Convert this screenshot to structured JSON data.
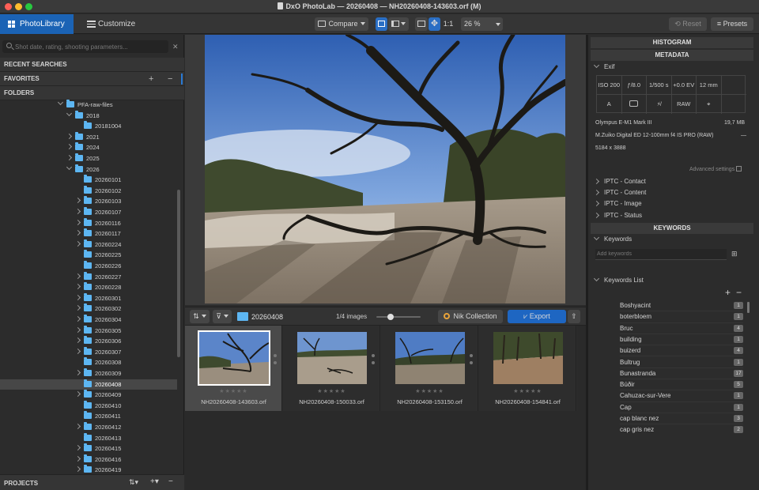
{
  "window": {
    "title": "DxO PhotoLab — 20260408 — NH20260408-143603.orf (M)"
  },
  "toolbar": {
    "tab_photolibrary": "PhotoLibrary",
    "tab_customize": "Customize",
    "compare_label": "Compare",
    "ratio_label": "1:1",
    "zoom_value": "26 %",
    "reset_label": "Reset",
    "presets_label": "Presets"
  },
  "left": {
    "search_placeholder": "Shot date, rating, shooting parameters...",
    "recent_searches": "RECENT SEARCHES",
    "favorites": "FAVORITES",
    "folders": "FOLDERS",
    "projects": "PROJECTS",
    "tree": [
      {
        "label": "PFA-raw-files",
        "depth": 0,
        "chevron": "open"
      },
      {
        "label": "2018",
        "depth": 1,
        "chevron": "open"
      },
      {
        "label": "20181004",
        "depth": 2,
        "chevron": "none"
      },
      {
        "label": "2021",
        "depth": 1,
        "chevron": "closed"
      },
      {
        "label": "2024",
        "depth": 1,
        "chevron": "closed"
      },
      {
        "label": "2025",
        "depth": 1,
        "chevron": "closed"
      },
      {
        "label": "2026",
        "depth": 1,
        "chevron": "open"
      },
      {
        "label": "20260101",
        "depth": 2,
        "chevron": "none"
      },
      {
        "label": "20260102",
        "depth": 2,
        "chevron": "none"
      },
      {
        "label": "20260103",
        "depth": 2,
        "chevron": "closed"
      },
      {
        "label": "20260107",
        "depth": 2,
        "chevron": "closed"
      },
      {
        "label": "20260116",
        "depth": 2,
        "chevron": "closed"
      },
      {
        "label": "20260117",
        "depth": 2,
        "chevron": "closed"
      },
      {
        "label": "20260224",
        "depth": 2,
        "chevron": "closed"
      },
      {
        "label": "20260225",
        "depth": 2,
        "chevron": "none"
      },
      {
        "label": "20260226",
        "depth": 2,
        "chevron": "none"
      },
      {
        "label": "20260227",
        "depth": 2,
        "chevron": "closed"
      },
      {
        "label": "20260228",
        "depth": 2,
        "chevron": "closed"
      },
      {
        "label": "20260301",
        "depth": 2,
        "chevron": "closed"
      },
      {
        "label": "20260302",
        "depth": 2,
        "chevron": "closed"
      },
      {
        "label": "20260304",
        "depth": 2,
        "chevron": "closed"
      },
      {
        "label": "20260305",
        "depth": 2,
        "chevron": "closed"
      },
      {
        "label": "20260306",
        "depth": 2,
        "chevron": "closed"
      },
      {
        "label": "20260307",
        "depth": 2,
        "chevron": "closed"
      },
      {
        "label": "20260308",
        "depth": 2,
        "chevron": "none"
      },
      {
        "label": "20260309",
        "depth": 2,
        "chevron": "closed"
      },
      {
        "label": "20260408",
        "depth": 2,
        "chevron": "none",
        "selected": true
      },
      {
        "label": "20260409",
        "depth": 2,
        "chevron": "closed"
      },
      {
        "label": "20260410",
        "depth": 2,
        "chevron": "none"
      },
      {
        "label": "20260411",
        "depth": 2,
        "chevron": "none"
      },
      {
        "label": "20260412",
        "depth": 2,
        "chevron": "closed"
      },
      {
        "label": "20260413",
        "depth": 2,
        "chevron": "none"
      },
      {
        "label": "20260415",
        "depth": 2,
        "chevron": "closed"
      },
      {
        "label": "20260416",
        "depth": 2,
        "chevron": "closed"
      },
      {
        "label": "20260419",
        "depth": 2,
        "chevron": "closed"
      }
    ]
  },
  "center": {
    "folder_name": "20260408",
    "image_count": "1/4 images",
    "nik_label": "Nik Collection",
    "export_label": "Export",
    "thumbnails": [
      {
        "name": "NH20260408-143603.orf",
        "selected": true
      },
      {
        "name": "NH20260408-150033.orf",
        "selected": false
      },
      {
        "name": "NH20260408-153150.orf",
        "selected": false
      },
      {
        "name": "NH20260408-154841.orf",
        "selected": false
      }
    ],
    "stars": "★★★★★"
  },
  "right": {
    "histogram": "HISTOGRAM",
    "metadata": "METADATA",
    "exif": "Exif",
    "exif_values": [
      "ISO 200",
      "ƒ/8.0",
      "1/500 s",
      "+0.0 EV",
      "12 mm"
    ],
    "exif_row2": [
      "A",
      "",
      "",
      "RAW",
      ""
    ],
    "camera": "Olympus E-M1 Mark III",
    "file_size": "19,7 MB",
    "lens": "M.Zuiko Digital ED 12-100mm f4 IS PRO (RAW)",
    "lens_extra": "—",
    "dimensions": "5184 x 3888",
    "advanced_settings": "Advanced settings",
    "iptc": [
      "IPTC - Contact",
      "IPTC - Content",
      "IPTC - Image",
      "IPTC - Status"
    ],
    "keywords_header": "KEYWORDS",
    "keywords_sub": "Keywords",
    "keywords_placeholder": "Add keywords",
    "keywords_list": "Keywords List",
    "keyword_items": [
      {
        "label": "Boshyacint",
        "count": "1"
      },
      {
        "label": "boterbloem",
        "count": "1"
      },
      {
        "label": "Bruc",
        "count": "4"
      },
      {
        "label": "building",
        "count": "1"
      },
      {
        "label": "buizerd",
        "count": "4"
      },
      {
        "label": "Bultrug",
        "count": "1"
      },
      {
        "label": "Bunastranda",
        "count": "17"
      },
      {
        "label": "Búðir",
        "count": "5"
      },
      {
        "label": "Cahuzac-sur-Vere",
        "count": "1"
      },
      {
        "label": "Cap",
        "count": "1"
      },
      {
        "label": "cap blanc nez",
        "count": "3"
      },
      {
        "label": "cap gris nez",
        "count": "2"
      }
    ]
  }
}
